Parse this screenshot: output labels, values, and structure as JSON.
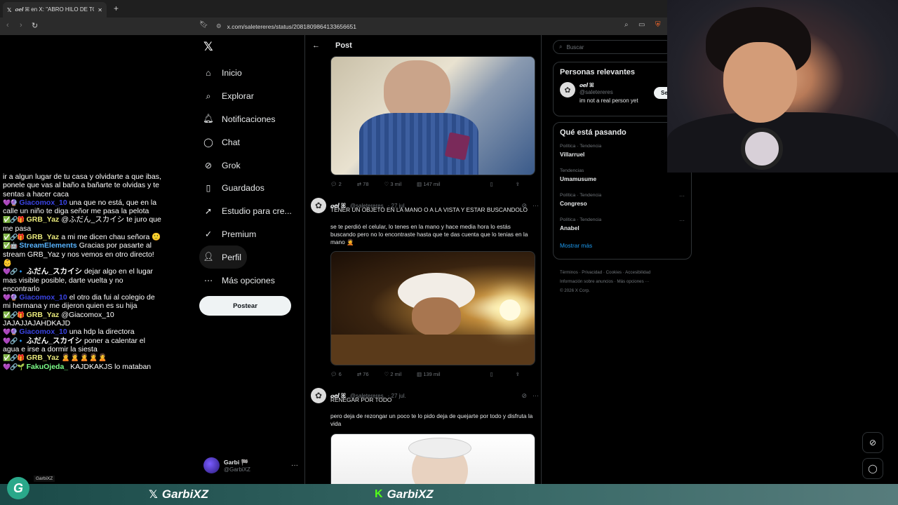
{
  "browser": {
    "tab_title": "𝒐𝒆𝒍 ꕤ en X: \"ABRO HILO DE TOD",
    "url": "x.com/saletereres/status/2081809864133656651"
  },
  "chat": [
    {
      "badges": "",
      "user": "",
      "user_color": "#fff",
      "text": "ir a algun lugar de tu casa y olvidarte a que ibas, ponele que vas al baño a bañarte te olvidas y te sentas a hacer caca"
    },
    {
      "badges": "💜🔮",
      "user": "Giacomox_10",
      "user_color": "#3a44e6",
      "text": "una que no está, que en la calle un niño te diga señor me pasa la pelota"
    },
    {
      "badges": "✅🔗🎁",
      "user": "GRB_Yaz",
      "user_color": "#e8e87a",
      "text": "@ふだん_スカイシ te juro que me pasa"
    },
    {
      "badges": "✅🔗🎁",
      "user": "GRB_Yaz",
      "user_color": "#e8e87a",
      "text": "a mi me dicen chau señora 🙂"
    },
    {
      "badges": "✅🤖",
      "user": "StreamElements",
      "user_color": "#58b4ff",
      "text": "Gracias por pasarte al stream GRB_Yaz y nos vemos en otro directo! 👶"
    },
    {
      "badges": "💜🔗🔹",
      "user": "ふだん_スカイシ",
      "user_color": "#fff",
      "text": "dejar algo en el lugar mas visible posible, darte vuelta y no encontrarlo"
    },
    {
      "badges": "💜🔮",
      "user": "Giacomox_10",
      "user_color": "#3a44e6",
      "text": "el otro dia fui al colegio de mi hermana y me dijeron quien es su hija"
    },
    {
      "badges": "✅🔗🎁",
      "user": "GRB_Yaz",
      "user_color": "#e8e87a",
      "text": "@Giacomox_10 JAJAJJAJAHDKAJD"
    },
    {
      "badges": "💜🔮",
      "user": "Giacomox_10",
      "user_color": "#3a44e6",
      "text": "una hdp la directora"
    },
    {
      "badges": "💜🔗🔹",
      "user": "ふだん_スカイシ",
      "user_color": "#fff",
      "text": "poner a calentar el agua e irse a dormir la siesta"
    },
    {
      "badges": "✅🔗🎁",
      "user": "GRB_Yaz",
      "user_color": "#e8e87a",
      "text": "🙎🙎🙎🙎🙎"
    },
    {
      "badges": "💜🔗🌱",
      "user": "FakuOjeda_",
      "user_color": "#7dff8a",
      "text": "KAJDKAKJS lo mataban"
    }
  ],
  "nav": {
    "items": [
      "Inicio",
      "Explorar",
      "Notificaciones",
      "Chat",
      "Grok",
      "Guardados",
      "Estudio para cre...",
      "Premium",
      "Perfil",
      "Más opciones"
    ],
    "post_button": "Postear",
    "account_name": "Garbi 🏁",
    "account_handle": "@GarbiXZ"
  },
  "post": {
    "header": "Post",
    "actions1": {
      "replies": "2",
      "reposts": "78",
      "likes": "3 mil",
      "views": "147 mil"
    },
    "tweet2": {
      "name": "𝒐𝒆𝒍 ꕤ",
      "handle": "@saletereres",
      "date": "· 27 jul.",
      "headline": "TENER UN OBJETO EN LA MANO O A LA VISTA Y ESTAR BUSCANDOLO",
      "body": "se te perdió el celular, lo tenes en la mano y hace media hora lo estás buscando pero no lo encontraste hasta que te das cuenta que lo tenias en la mano 🤦"
    },
    "actions2": {
      "replies": "6",
      "reposts": "76",
      "likes": "2 mil",
      "views": "139 mil"
    },
    "tweet3": {
      "name": "𝒐𝒆𝒍 ꕤ",
      "handle": "@saletereres",
      "date": "· 27 jul.",
      "headline": "RENEGAR POR TODO",
      "body": "pero deja de rezongar un poco te lo pido deja de quejarte por todo y disfruta la vida"
    }
  },
  "right": {
    "search_placeholder": "Buscar",
    "relevant_title": "Personas relevantes",
    "rel_name": "𝒐𝒆𝒍 ꕤ",
    "rel_handle": "@saletereres",
    "rel_bio": "im not a real person yet",
    "follow_label": "Se",
    "trending_title": "Qué está pasando",
    "trends": [
      {
        "context": "Política · Tendencia",
        "name": "Villarruel"
      },
      {
        "context": "Tendencias",
        "name": "Umamusume"
      },
      {
        "context": "Política · Tendencia",
        "name": "Congreso"
      },
      {
        "context": "Política · Tendencia",
        "name": "Anabel"
      }
    ],
    "show_more": "Mostrar más",
    "footer1": "Términos · Privacidad · Cookies · Accesibilidad",
    "footer2": "Información sobre anuncios · Más opciones ···",
    "footer3": "© 2026 X Corp."
  },
  "overlay": {
    "small_label": "GarbiXZ",
    "x_brand": "GarbiXZ",
    "kick_brand": "GarbiXZ"
  }
}
